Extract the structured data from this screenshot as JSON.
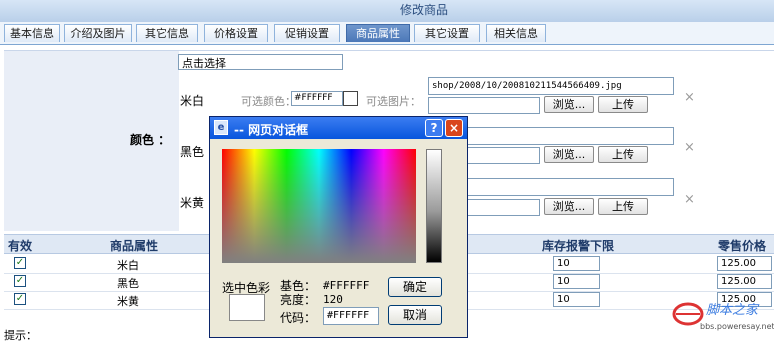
{
  "window": {
    "title": "修改商品"
  },
  "tabs": [
    {
      "label": "基本信息",
      "active": false
    },
    {
      "label": "介绍及图片",
      "active": false
    },
    {
      "label": "其它信息",
      "active": false
    },
    {
      "label": "价格设置",
      "active": false
    },
    {
      "label": "促销设置",
      "active": false
    },
    {
      "label": "商品属性",
      "active": true
    },
    {
      "label": "其它设置",
      "active": false
    },
    {
      "label": "相关信息",
      "active": false
    }
  ],
  "color_section": {
    "label": "颜色 ：",
    "picker_value": "点击选择",
    "optional_color_label": "可选颜色：",
    "optional_image_label": "可选图片：",
    "browse_label": "浏览...",
    "upload_label": "上传",
    "delete_label": "×",
    "items": [
      {
        "name": "米白",
        "color": "#FFFFFF",
        "image_path": "shop/2008/10/200810211544566409.jpg"
      },
      {
        "name": "黑色"
      },
      {
        "name": "米黄"
      }
    ]
  },
  "attr_table": {
    "headers": {
      "valid": "有效",
      "attribute": "商品属性",
      "stock_alert": "库存报警下限",
      "price": "零售价格"
    },
    "rows": [
      {
        "name": "米白",
        "checked": true,
        "stock_alert": "10",
        "price": "125.00"
      },
      {
        "name": "黑色",
        "checked": true,
        "stock_alert": "10",
        "price": "125.00"
      },
      {
        "name": "米黄",
        "checked": true,
        "stock_alert": "10",
        "price": "125.00"
      }
    ],
    "check_mark": "✓"
  },
  "tip": "提示：",
  "dialog": {
    "title": "--  网页对话框",
    "help": "?",
    "close": "×",
    "selected_color_label": "选中色彩",
    "base_color_label": "基色：",
    "base_color_value": "#FFFFFF",
    "brightness_label": "亮度：",
    "brightness_value": "120",
    "code_label": "代码：",
    "code_value": "#FFFFFF",
    "ok_label": "确定",
    "cancel_label": "取消",
    "selected_color": "#FFFFFF"
  },
  "watermark": {
    "line1": "脚本之家",
    "line2": "bbs.poweresay.net"
  }
}
